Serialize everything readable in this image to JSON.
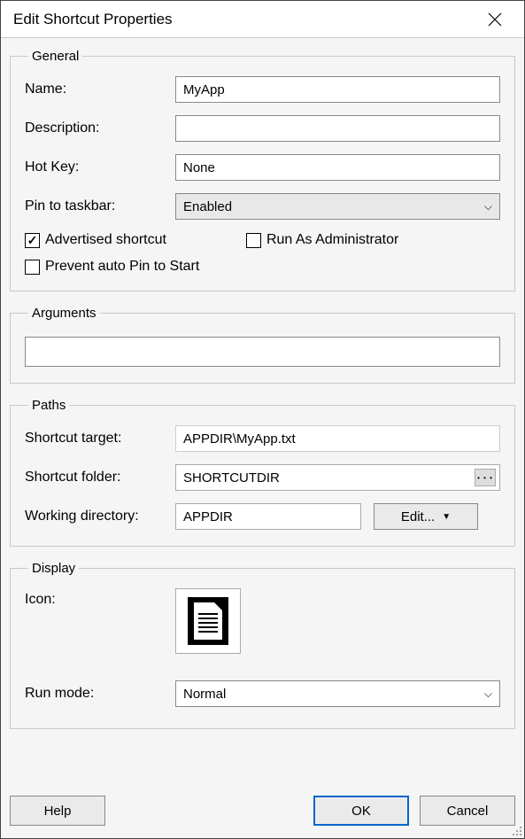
{
  "window": {
    "title": "Edit Shortcut Properties"
  },
  "general": {
    "legend": "General",
    "name_label": "Name:",
    "name_value": "MyApp",
    "description_label": "Description:",
    "description_value": "",
    "hotkey_label": "Hot Key:",
    "hotkey_value": "None",
    "pin_label": "Pin to taskbar:",
    "pin_value": "Enabled",
    "advertised_label": "Advertised shortcut",
    "advertised_checked": true,
    "runas_label": "Run As Administrator",
    "runas_checked": false,
    "prevent_label": "Prevent auto Pin to Start",
    "prevent_checked": false
  },
  "arguments": {
    "legend": "Arguments",
    "value": ""
  },
  "paths": {
    "legend": "Paths",
    "target_label": "Shortcut target:",
    "target_value": "APPDIR\\MyApp.txt",
    "folder_label": "Shortcut folder:",
    "folder_value": "SHORTCUTDIR",
    "wd_label": "Working directory:",
    "wd_value": "APPDIR",
    "edit_label": "Edit..."
  },
  "display": {
    "legend": "Display",
    "icon_label": "Icon:",
    "runmode_label": "Run mode:",
    "runmode_value": "Normal"
  },
  "buttons": {
    "help": "Help",
    "ok": "OK",
    "cancel": "Cancel"
  }
}
